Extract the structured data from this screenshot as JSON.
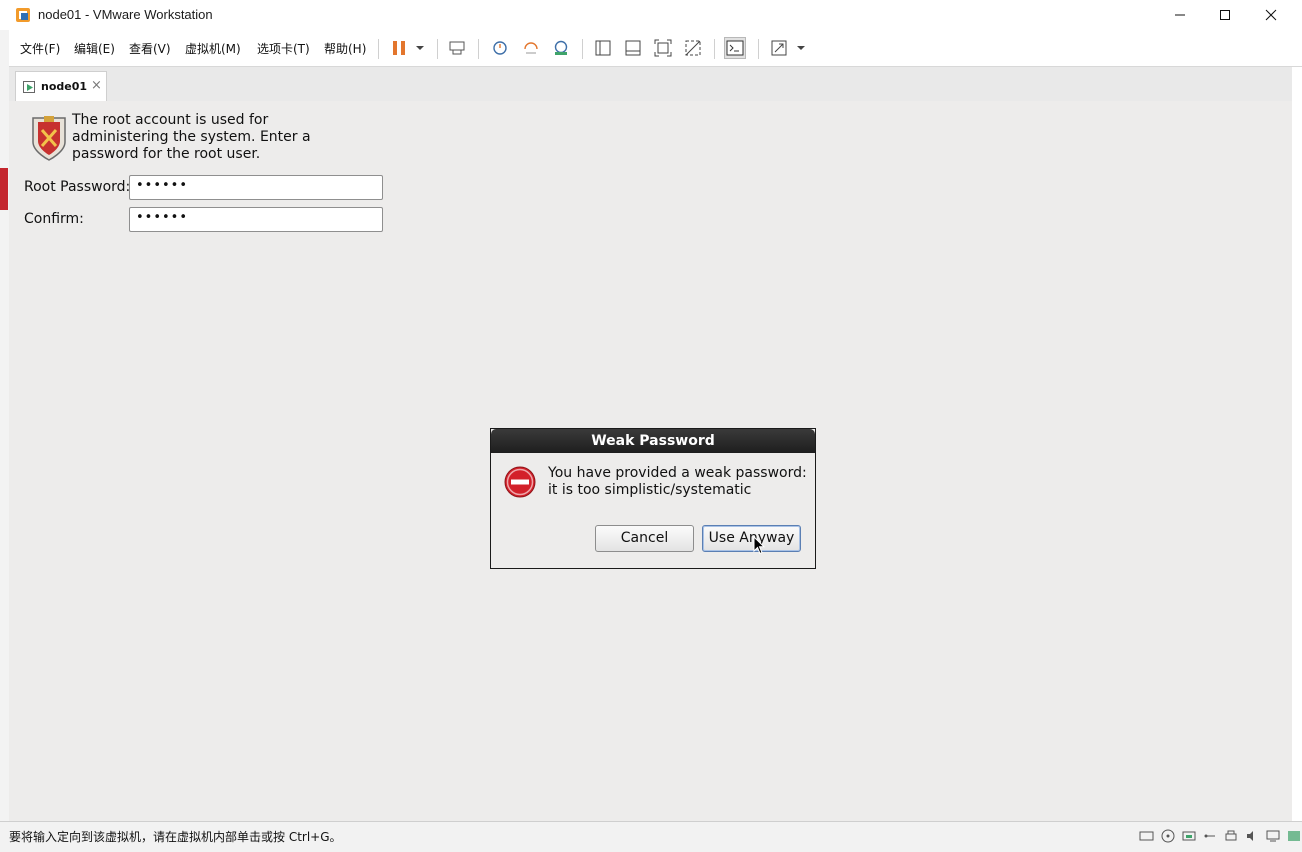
{
  "window": {
    "title": "node01 - VMware Workstation",
    "app_icon": "vmware-icon"
  },
  "menu": {
    "items": [
      "文件(F)",
      "编辑(E)",
      "查看(V)",
      "虚拟机(M)",
      "选项卡(T)",
      "帮助(H)"
    ]
  },
  "toolbar": {
    "icons": [
      "pause-icon",
      "dropdown-arrow-icon",
      "send-ctrl-alt-del-icon",
      "snapshot-icon",
      "revert-snapshot-icon",
      "snapshot-manager-icon",
      "library-view-icon",
      "thumbnail-view-icon",
      "fullscreen-icon",
      "unity-icon",
      "console-view-icon",
      "stretch-icon"
    ],
    "accent_color": "#e3762d"
  },
  "tab": {
    "label": "node01",
    "close": "×"
  },
  "guest": {
    "description": "The root account is used for administering the system.  Enter a password for the root user.",
    "root_password_label": "Root Password:",
    "root_password_value": "••••••",
    "confirm_label": "Confirm:",
    "confirm_value": "••••••"
  },
  "dialog": {
    "title": "Weak Password",
    "message": "You have provided a weak password: it is too simplistic/systematic",
    "cancel_label": "Cancel",
    "use_anyway_label": "Use Anyway",
    "error_color": "#d3202a"
  },
  "statusbar": {
    "text": "要将输入定向到该虚拟机，请在虚拟机内部单击或按 Ctrl+G。"
  }
}
